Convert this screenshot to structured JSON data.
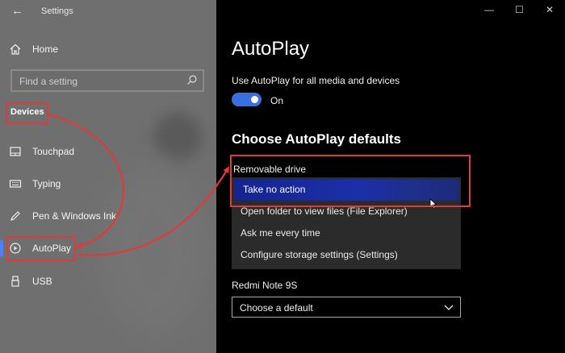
{
  "window": {
    "app_title": "Settings"
  },
  "nav": {
    "home": "Home",
    "search_placeholder": "Find a setting",
    "category": "Devices",
    "items": [
      {
        "label": "Touchpad",
        "icon": "touchpad-icon"
      },
      {
        "label": "Typing",
        "icon": "keyboard-icon"
      },
      {
        "label": "Pen & Windows Ink",
        "icon": "pen-icon"
      },
      {
        "label": "AutoPlay",
        "icon": "autoplay-icon"
      },
      {
        "label": "USB",
        "icon": "usb-icon"
      }
    ]
  },
  "page": {
    "title": "AutoPlay",
    "toggle_label": "Use AutoPlay for all media and devices",
    "toggle_state": "On",
    "section_title": "Choose AutoPlay defaults",
    "removable_label": "Removable drive",
    "removable_options": [
      "Take no action",
      "Open folder to view files (File Explorer)",
      "Ask me every time",
      "Configure storage settings (Settings)"
    ],
    "device2_label": "Redmi Note 9S",
    "device2_value": "Choose a default"
  },
  "colors": {
    "accent": "#3a6fe0",
    "highlight_box": "#e03a3a",
    "selected_option": "#1b2fa8"
  }
}
